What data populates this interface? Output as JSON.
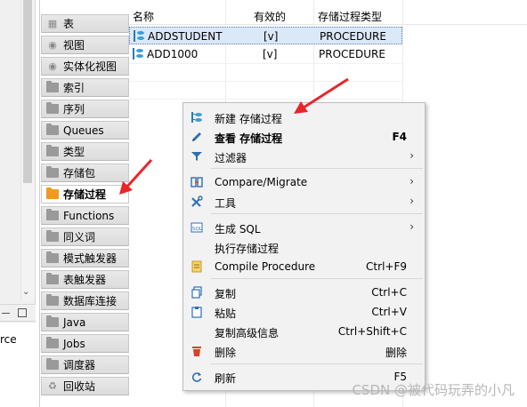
{
  "left_panel": {
    "truncated_text": "rce",
    "icons": {
      "minimize": "minimize-icon",
      "maximize": "maximize-icon",
      "scroll_down": "chevron-down-icon"
    }
  },
  "tabs": [
    {
      "label": "表",
      "icon": "table-icon"
    },
    {
      "label": "视图",
      "icon": "eye-icon"
    },
    {
      "label": "实体化视图",
      "icon": "eye-icon"
    },
    {
      "label": "索引",
      "icon": "folder-icon"
    },
    {
      "label": "序列",
      "icon": "folder-icon"
    },
    {
      "label": "Queues",
      "icon": "folder-icon"
    },
    {
      "label": "类型",
      "icon": "folder-icon"
    },
    {
      "label": "存储包",
      "icon": "folder-icon"
    },
    {
      "label": "存储过程",
      "icon": "folder-icon",
      "active": true
    },
    {
      "label": "Functions",
      "icon": "folder-icon"
    },
    {
      "label": "同义词",
      "icon": "folder-icon"
    },
    {
      "label": "模式触发器",
      "icon": "folder-icon"
    },
    {
      "label": "表触发器",
      "icon": "folder-icon"
    },
    {
      "label": "数据库连接",
      "icon": "folder-icon"
    },
    {
      "label": "Java",
      "icon": "folder-icon"
    },
    {
      "label": "Jobs",
      "icon": "folder-icon"
    },
    {
      "label": "调度器",
      "icon": "folder-icon"
    },
    {
      "label": "回收站",
      "icon": "recycle-icon"
    }
  ],
  "table": {
    "columns": [
      "名称",
      "有效的",
      "存储过程类型"
    ],
    "rows": [
      {
        "name": "ADDSTUDENT",
        "valid": "[v]",
        "type": "PROCEDURE",
        "selected": true
      },
      {
        "name": "ADD1000",
        "valid": "[v]",
        "type": "PROCEDURE",
        "selected": false
      }
    ]
  },
  "context_menu": {
    "items": [
      {
        "label": "新建 存储过程",
        "shortcut": "",
        "icon": "new-procedure-icon"
      },
      {
        "label": "查看 存储过程",
        "shortcut": "F4",
        "icon": "pencil-icon",
        "bold": true
      },
      {
        "label": "过滤器",
        "shortcut": "",
        "icon": "filter-icon",
        "submenu": true
      },
      {
        "label": "Compare/Migrate",
        "shortcut": "",
        "icon": "compare-icon",
        "submenu": true
      },
      {
        "label": "工具",
        "shortcut": "",
        "icon": "tools-icon",
        "submenu": true
      },
      {
        "label": "生成 SQL",
        "shortcut": "",
        "icon": "sql-icon",
        "submenu": true
      },
      {
        "label": "执行存储过程",
        "shortcut": "",
        "icon": ""
      },
      {
        "label": "Compile Procedure",
        "shortcut": "Ctrl+F9",
        "icon": "compile-icon"
      },
      {
        "label": "复制",
        "shortcut": "Ctrl+C",
        "icon": "copy-icon"
      },
      {
        "label": "粘贴",
        "shortcut": "Ctrl+V",
        "icon": "paste-icon"
      },
      {
        "label": "复制高级信息",
        "shortcut": "Ctrl+Shift+C",
        "icon": ""
      },
      {
        "label": "删除",
        "shortcut": "删除",
        "icon": "delete-icon"
      },
      {
        "label": "刷新",
        "shortcut": "F5",
        "icon": "refresh-icon"
      }
    ]
  },
  "watermark": "CSDN @被代码玩弄的小凡",
  "colors": {
    "accent_arrow": "#e8262a",
    "selection": "#dbe8f8",
    "active_folder": "#f29a1f"
  }
}
